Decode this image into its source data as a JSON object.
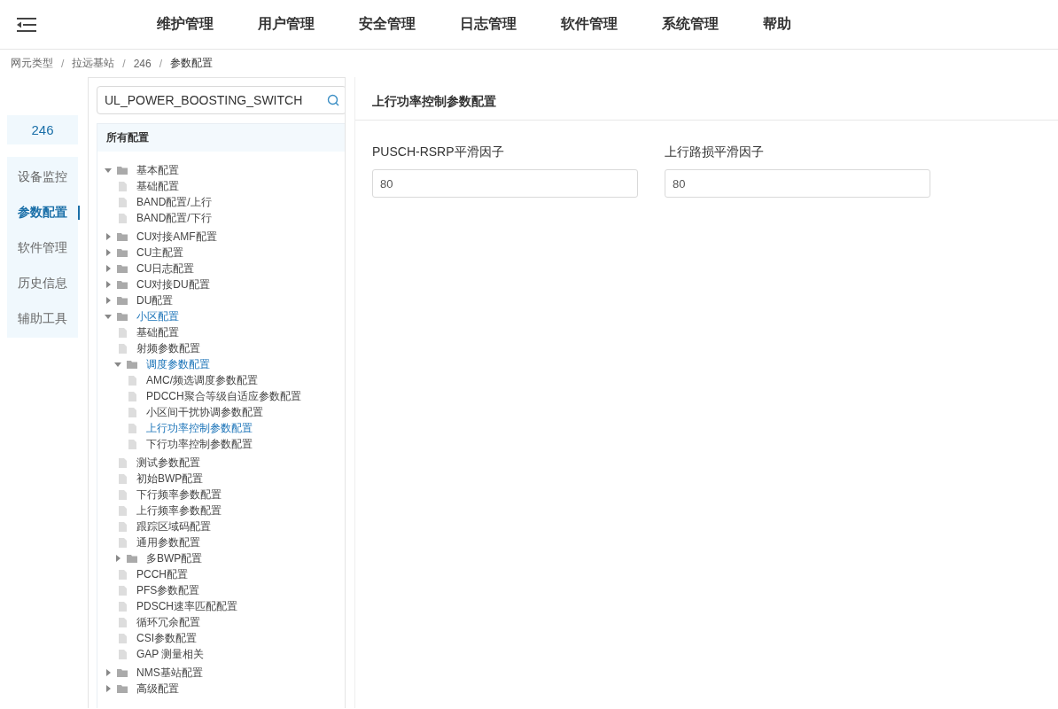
{
  "header": {
    "menu": [
      "维护管理",
      "用户管理",
      "安全管理",
      "日志管理",
      "软件管理",
      "系统管理",
      "帮助"
    ]
  },
  "breadcrumb": [
    {
      "kind": "link",
      "text": "网元类型"
    },
    {
      "kind": "separator",
      "text": "/"
    },
    {
      "kind": "link",
      "text": "拉远基站"
    },
    {
      "kind": "separator",
      "text": "/"
    },
    {
      "kind": "link",
      "text": "246"
    },
    {
      "kind": "separator",
      "text": "/"
    },
    {
      "kind": "current",
      "text": "参数配置"
    }
  ],
  "sidebar": {
    "title": "246",
    "items": [
      {
        "label": "设备监控",
        "selected": false
      },
      {
        "label": "参数配置",
        "selected": true
      },
      {
        "label": "软件管理",
        "selected": false
      },
      {
        "label": "历史信息",
        "selected": false
      },
      {
        "label": "辅助工具",
        "selected": false
      }
    ]
  },
  "tree_panel": {
    "search": {
      "value": "UL_POWER_BOOSTING_SWITCH"
    },
    "root": "所有配置",
    "nodes": [
      {
        "label": "基本配置",
        "kind": "folder",
        "expanded": true,
        "highlighted": false,
        "children": [
          {
            "label": "基础配置",
            "kind": "file",
            "highlighted": false
          },
          {
            "label": "BAND配置/上行",
            "kind": "file",
            "highlighted": false
          },
          {
            "label": "BAND配置/下行",
            "kind": "file",
            "highlighted": false
          }
        ]
      },
      {
        "label": "CU对接AMF配置",
        "kind": "folder",
        "expanded": false,
        "highlighted": false
      },
      {
        "label": "CU主配置",
        "kind": "folder",
        "expanded": false,
        "highlighted": false
      },
      {
        "label": "CU日志配置",
        "kind": "folder",
        "expanded": false,
        "highlighted": false
      },
      {
        "label": "CU对接DU配置",
        "kind": "folder",
        "expanded": false,
        "highlighted": false
      },
      {
        "label": "DU配置",
        "kind": "folder",
        "expanded": false,
        "highlighted": false
      },
      {
        "label": "小区配置",
        "kind": "folder",
        "expanded": true,
        "highlighted": true,
        "children": [
          {
            "label": "基础配置",
            "kind": "file",
            "highlighted": false
          },
          {
            "label": "射频参数配置",
            "kind": "file",
            "highlighted": false
          },
          {
            "label": "调度参数配置",
            "kind": "folder",
            "expanded": true,
            "highlighted": true,
            "children": [
              {
                "label": "AMC/频选调度参数配置",
                "kind": "file",
                "highlighted": false
              },
              {
                "label": "PDCCH聚合等级自适应参数配置",
                "kind": "file",
                "highlighted": false
              },
              {
                "label": "小区间干扰协调参数配置",
                "kind": "file",
                "highlighted": false
              },
              {
                "label": "上行功率控制参数配置",
                "kind": "file",
                "highlighted": true
              },
              {
                "label": "下行功率控制参数配置",
                "kind": "file",
                "highlighted": false
              }
            ]
          },
          {
            "label": "测试参数配置",
            "kind": "file",
            "highlighted": false
          },
          {
            "label": "初始BWP配置",
            "kind": "file",
            "highlighted": false
          },
          {
            "label": "下行频率参数配置",
            "kind": "file",
            "highlighted": false
          },
          {
            "label": "上行频率参数配置",
            "kind": "file",
            "highlighted": false
          },
          {
            "label": "跟踪区域码配置",
            "kind": "file",
            "highlighted": false
          },
          {
            "label": "通用参数配置",
            "kind": "file",
            "highlighted": false
          },
          {
            "label": "多BWP配置",
            "kind": "folder",
            "expanded": false,
            "highlighted": false
          },
          {
            "label": "PCCH配置",
            "kind": "file",
            "highlighted": false
          },
          {
            "label": "PFS参数配置",
            "kind": "file",
            "highlighted": false
          },
          {
            "label": "PDSCH速率匹配配置",
            "kind": "file",
            "highlighted": false
          },
          {
            "label": "循环冗余配置",
            "kind": "file",
            "highlighted": false
          },
          {
            "label": "CSI参数配置",
            "kind": "file",
            "highlighted": false
          },
          {
            "label": "GAP 测量相关",
            "kind": "file",
            "highlighted": false
          }
        ]
      },
      {
        "label": "NMS基站配置",
        "kind": "folder",
        "expanded": false,
        "highlighted": false
      },
      {
        "label": "高级配置",
        "kind": "folder",
        "expanded": false,
        "highlighted": false
      }
    ]
  },
  "content": {
    "title": "上行功率控制参数配置",
    "fields": [
      {
        "label": "PUSCH-RSRP平滑因子",
        "value": "80"
      },
      {
        "label": "上行路损平滑因子",
        "value": "80"
      }
    ]
  }
}
